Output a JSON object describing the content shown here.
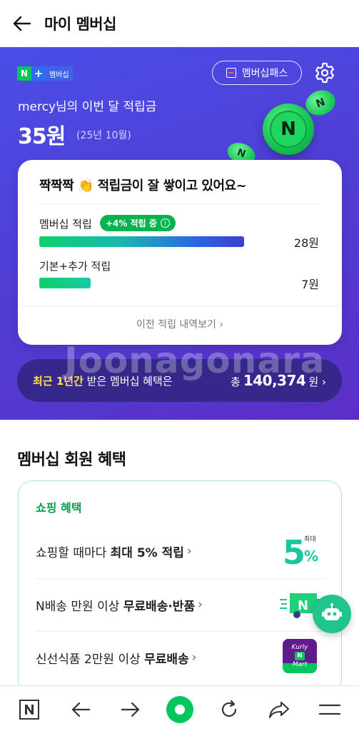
{
  "header": {
    "title": "마이 멤버십"
  },
  "hero": {
    "badge_n": "N",
    "badge_plus": "+",
    "badge_label": "멤버십",
    "pass_label": "멤버십패스",
    "greeting": "mercy님의 이번 달 적립금",
    "amount": "35원",
    "period": "(25년 10월)",
    "coin_symbol": "N",
    "card": {
      "headline": "짝짝짝 👏 적립금이 잘 쌓이고 있어요~",
      "membership_label": "멤버십 적립",
      "chip_label": "+4% 적립 중",
      "chip_info": "i",
      "membership_value": "28원",
      "membership_fill": 1.0,
      "basic_label": "기본+추가 적립",
      "basic_value": "7원",
      "basic_fill": 0.25,
      "history_link": "이전 적립 내역보기 ›"
    },
    "benefit": {
      "highlight": "최근 1년간",
      "text": " 받은 멤버십 혜택은",
      "prefix": "총",
      "number": "140,374",
      "unit": "원 ›"
    }
  },
  "section": {
    "title": "멤버십 회원 혜택",
    "shop_title": "쇼핑 혜택",
    "rows": [
      {
        "pre": "쇼핑할 때마다 ",
        "bold": "최대 5% 적립",
        "chev": "›"
      },
      {
        "pre": "N배송 만원 이상 ",
        "bold": "무료배송·반품",
        "chev": "›"
      },
      {
        "pre": "신선식품 2만원 이상 ",
        "bold": "무료배송",
        "chev": "›"
      }
    ],
    "pct_icon": {
      "small": "최대",
      "big": "5",
      "sign": "%"
    },
    "truck_icon": {
      "letter": "N"
    },
    "kurly_icon": {
      "top": "Kurly",
      "mid": "N",
      "bottom": "Mart"
    }
  },
  "watermark": "Joonagonara",
  "colors": {
    "naver_green": "#03c75a",
    "hero_blue": "#4a4ee8",
    "highlight_yellow": "#ffe14a"
  }
}
